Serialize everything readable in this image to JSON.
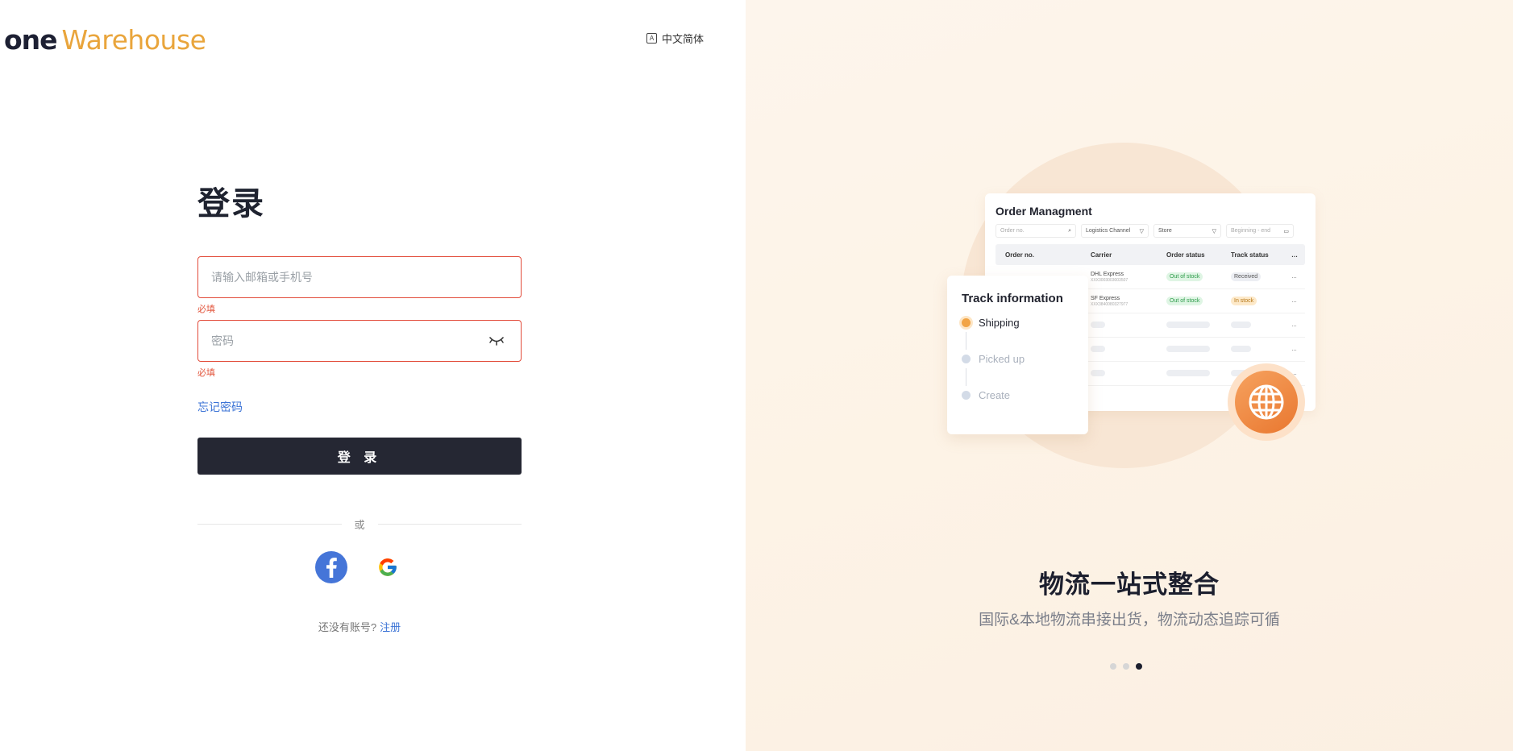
{
  "header": {
    "logo_one": "one",
    "logo_warehouse": "Warehouse",
    "language_label": "中文简体"
  },
  "login": {
    "title": "登录",
    "account_placeholder": "请输入邮箱或手机号",
    "account_error": "必填",
    "password_placeholder": "密码",
    "password_error": "必填",
    "forgot_label": "忘记密码",
    "submit_label": "登 录",
    "divider_label": "或",
    "no_account_text": "还没有账号?",
    "signup_link": "注册"
  },
  "illustration": {
    "order_card": {
      "title": "Order Managment",
      "filters": [
        "Order no.",
        "Logistics Channel",
        "Store",
        "Beginning - end"
      ],
      "columns": [
        "Order no.",
        "Carrier",
        "Order status",
        "Track status"
      ],
      "rows": [
        {
          "carrier": "DHL Express",
          "carrier_no": "XXX3003003003507",
          "order_status": "Out of stock",
          "track_status": "Received"
        },
        {
          "carrier": "SF Express",
          "carrier_no": "XXX3840080327977",
          "order_status": "Out of stock",
          "track_status": "In stock"
        }
      ]
    },
    "track_card": {
      "title": "Track information",
      "steps": [
        "Shipping",
        "Picked up",
        "Create"
      ]
    }
  },
  "promo": {
    "title": "物流一站式整合",
    "subtitle": "国际&本地物流串接出货，物流动态追踪可循"
  },
  "carousel": {
    "count": 3,
    "active_index": 2
  },
  "colors": {
    "accent": "#e9a53c",
    "primary_button": "#252733",
    "error": "#e24b3a",
    "link": "#3b73d6",
    "facebook": "#4575d8"
  }
}
